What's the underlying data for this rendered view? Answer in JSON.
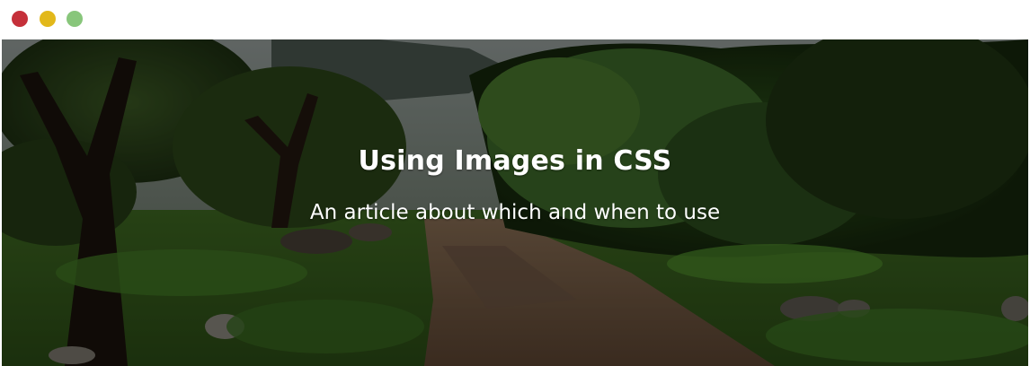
{
  "window": {
    "controls": [
      {
        "name": "close",
        "color": "#c5303a"
      },
      {
        "name": "minimize",
        "color": "#e2b81a"
      },
      {
        "name": "zoom",
        "color": "#88c67b"
      }
    ]
  },
  "hero": {
    "title": "Using Images in CSS",
    "subtitle": "An article about which and when to use",
    "background_image": "forest-path-photo"
  }
}
